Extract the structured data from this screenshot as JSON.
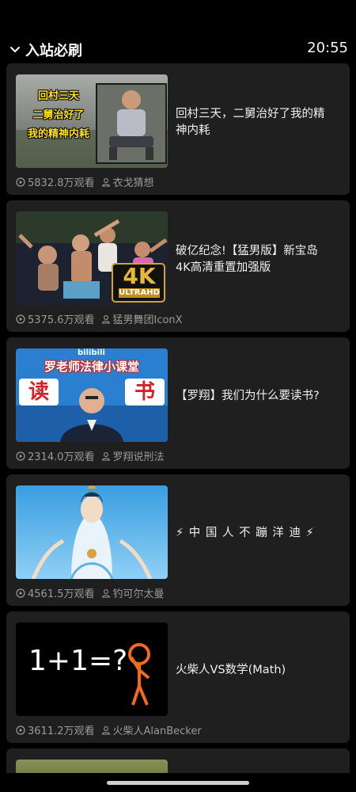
{
  "header": {
    "title": "入站必刷",
    "time": "20:55"
  },
  "videos": [
    {
      "title": "回村三天，二舅治好了我的精神内耗",
      "views": "5832.8万观看",
      "author": "衣戈猜想",
      "thumb_text": [
        "回村三天",
        "二舅治好了",
        "我的精神内耗"
      ]
    },
    {
      "title": "破亿纪念!【猛男版】新宝岛 4K高清重置加强版",
      "views": "5375.6万观看",
      "author": "猛男舞团IconX",
      "thumb_badge": "4K",
      "thumb_badge_sub": "ULTRAHD"
    },
    {
      "title": "【罗翔】我们为什么要读书?",
      "views": "2314.0万观看",
      "author": "罗翔说刑法",
      "thumb_logo": "bilibili",
      "thumb_banner": "罗老师法律小课堂",
      "thumb_left": "读",
      "thumb_right": "书"
    },
    {
      "title": "⚡ 中 国 人 不 蹦 洋 迪 ⚡",
      "views": "4561.5万观看",
      "author": "钓可尔太曼"
    },
    {
      "title": "火柴人VS数学(Math)",
      "views": "3611.2万观看",
      "author": "火柴人AlanBecker",
      "thumb_equation": "1+1=?"
    }
  ],
  "colors": {
    "background": "#000000",
    "card": "#1f1f1f",
    "meta_text": "#9a9a9a",
    "stickman": "#f26a1b"
  }
}
